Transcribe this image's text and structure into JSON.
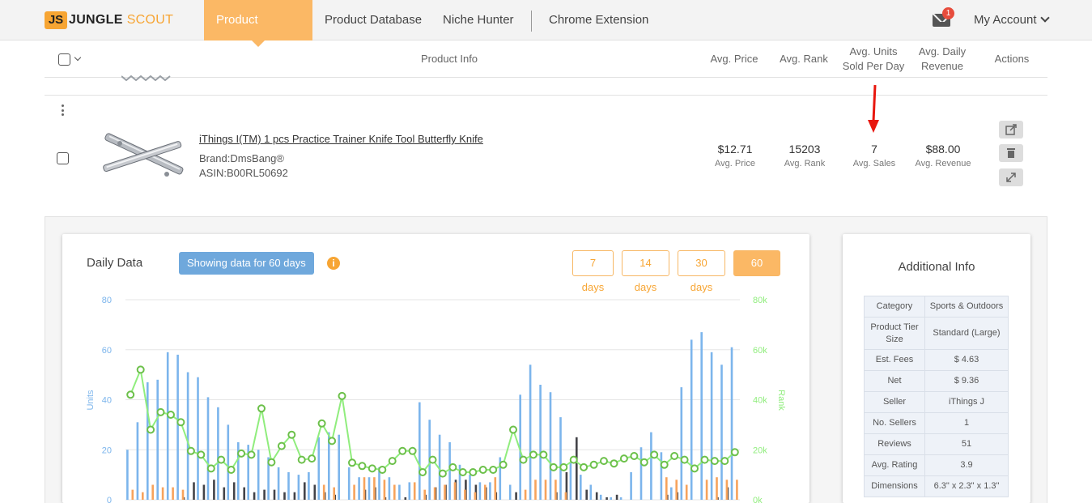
{
  "nav": {
    "logo_mark": "JS",
    "logo_jungle": "JUNGLE",
    "logo_scout": "SCOUT",
    "items": [
      {
        "label": "Product Tracker",
        "active": true
      },
      {
        "label": "Product Database",
        "active": false
      },
      {
        "label": "Niche Hunter",
        "active": false
      },
      {
        "label": "Chrome Extension",
        "active": false
      }
    ],
    "notification_count": "1",
    "account_label": "My Account"
  },
  "table_header": {
    "product_info": "Product Info",
    "avg_price": "Avg. Price",
    "avg_rank": "Avg. Rank",
    "avg_units_line1": "Avg. Units",
    "avg_units_line2": "Sold Per Day",
    "avg_revenue_line1": "Avg. Daily",
    "avg_revenue_line2": "Revenue",
    "actions": "Actions"
  },
  "product": {
    "title": "iThings I(TM) 1 pcs Practice Trainer Knife Tool Butterfly Knife",
    "brand_label": "Brand:",
    "brand": "DmsBang®",
    "asin_label": "ASIN:",
    "asin": "B00RL50692",
    "avg_price": "$12.71",
    "avg_price_label": "Avg. Price",
    "avg_rank": "15203",
    "avg_rank_label": "Avg. Rank",
    "avg_sales": "7",
    "avg_sales_label": "Avg. Sales",
    "avg_revenue": "$88.00",
    "avg_revenue_label": "Avg. Revenue",
    "actions": [
      "external-link-icon",
      "trash-icon",
      "expand-icon"
    ]
  },
  "daily": {
    "title": "Daily Data",
    "showing": "Showing data for 60 days",
    "ranges": [
      {
        "label": "7 days",
        "active": false
      },
      {
        "label": "14 days",
        "active": false
      },
      {
        "label": "30 days",
        "active": false
      },
      {
        "label": "60 days",
        "active": true
      }
    ]
  },
  "chart_data": {
    "type": "bar",
    "ylabel": "Units",
    "y2label": "Rank",
    "ylim": [
      0,
      80
    ],
    "y2lim": [
      0,
      80000
    ],
    "yticks": [
      "0",
      "20",
      "40",
      "60",
      "80"
    ],
    "y2ticks": [
      "0k",
      "20k",
      "40k",
      "60k",
      "80k"
    ],
    "colors": {
      "series_a": "#7cb5ec",
      "series_b": "#434348",
      "series_c": "#f7a35c",
      "rank": "#90ed7d"
    },
    "series": [
      {
        "values": [
          20,
          31,
          47,
          48,
          59,
          58,
          51,
          49,
          41,
          37,
          30,
          23,
          22,
          20,
          17,
          13,
          11,
          10,
          11,
          25,
          27,
          26,
          13,
          9,
          9,
          13,
          9,
          6,
          7,
          39,
          32,
          26,
          23,
          14,
          10,
          7,
          7,
          17,
          6,
          42,
          54,
          46,
          43,
          33,
          15,
          10,
          6,
          2,
          1,
          1,
          11,
          21,
          27,
          19,
          5,
          45,
          64,
          67,
          59,
          54,
          61
        ]
      },
      {
        "values": [
          0,
          0,
          0,
          0,
          0,
          1,
          7,
          6,
          8,
          5,
          7,
          5,
          3,
          4,
          4,
          3,
          3,
          7,
          6,
          3,
          2,
          0,
          0,
          4,
          5,
          1,
          0,
          1,
          0,
          2,
          5,
          6,
          8,
          8,
          6,
          5,
          3,
          0,
          3,
          0,
          0,
          0,
          3,
          11,
          25,
          4,
          3,
          1,
          2,
          0,
          0,
          0,
          0,
          2,
          3,
          0,
          0,
          0,
          1,
          5,
          0
        ]
      },
      {
        "values": [
          4,
          3,
          6,
          5,
          5,
          4,
          0,
          0,
          0,
          0,
          0,
          0,
          0,
          0,
          0,
          0,
          0,
          0,
          0,
          6,
          5,
          0,
          6,
          9,
          9,
          8,
          6,
          0,
          7,
          4,
          5,
          6,
          7,
          4,
          3,
          6,
          9,
          0,
          0,
          4,
          8,
          8,
          8,
          3,
          0,
          0,
          0,
          0,
          0,
          0,
          0,
          0,
          0,
          9,
          8,
          6,
          0,
          8,
          9,
          8,
          8
        ]
      },
      {
        "name": "Rank",
        "values": [
          42000,
          52000,
          28000,
          35000,
          34000,
          31000,
          19500,
          18000,
          12500,
          16000,
          12000,
          18500,
          18000,
          36500,
          15000,
          21500,
          26000,
          16000,
          16500,
          30500,
          23500,
          41500,
          14800,
          13500,
          12500,
          12000,
          15500,
          19500,
          19500,
          11000,
          16000,
          10500,
          13000,
          11000,
          11000,
          12000,
          12000,
          14000,
          28000,
          16000,
          18000,
          18000,
          13000,
          13000,
          16000,
          13000,
          14000,
          15500,
          14500,
          16500,
          17500,
          15000,
          18000,
          14000,
          17500,
          16000,
          12500,
          16000,
          15500,
          15500,
          19000
        ]
      }
    ]
  },
  "additional": {
    "title": "Additional Info",
    "rows": [
      {
        "k": "Category",
        "v": "Sports & Outdoors"
      },
      {
        "k": "Product Tier Size",
        "v": "Standard (Large)"
      },
      {
        "k": "Est. Fees",
        "v": "$ 4.63"
      },
      {
        "k": "Net",
        "v": "$ 9.36"
      },
      {
        "k": "Seller",
        "v": "iThings J"
      },
      {
        "k": "No. Sellers",
        "v": "1"
      },
      {
        "k": "Reviews",
        "v": "51"
      },
      {
        "k": "Avg. Rating",
        "v": "3.9"
      },
      {
        "k": "Dimensions",
        "v": "6.3\" x 2.3\" x 1.3\""
      }
    ]
  }
}
